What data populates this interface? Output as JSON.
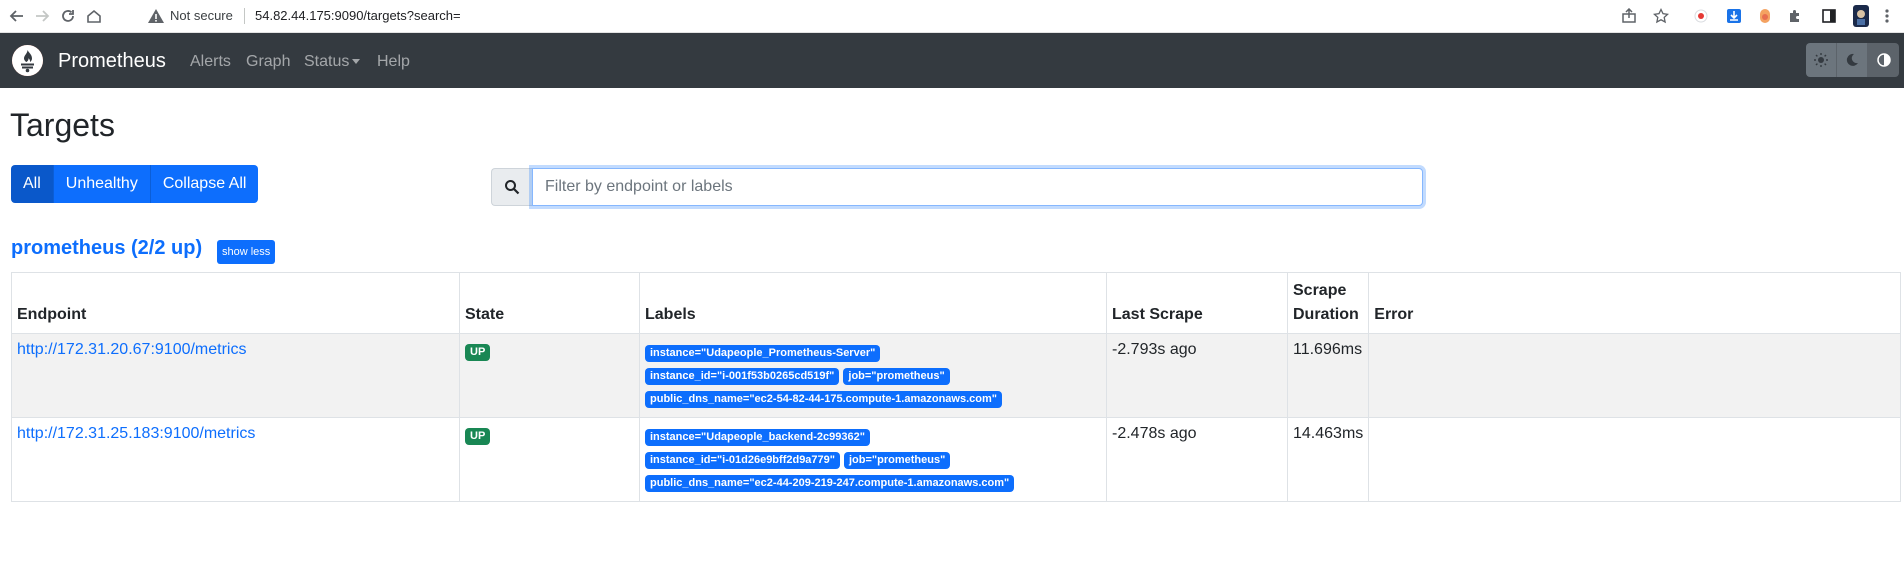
{
  "browser": {
    "security_label": "Not secure",
    "url": "54.82.44.175:9090/targets?search="
  },
  "navbar": {
    "brand": "Prometheus",
    "links": [
      {
        "label": "Alerts"
      },
      {
        "label": "Graph"
      },
      {
        "label": "Status"
      },
      {
        "label": "Help"
      }
    ]
  },
  "page": {
    "title": "Targets",
    "filter_buttons": [
      "All",
      "Unhealthy",
      "Collapse All"
    ],
    "active_filter": "All",
    "search_placeholder": "Filter by endpoint or labels"
  },
  "pool": {
    "title": "prometheus (2/2 up)",
    "toggle_label": "show less",
    "columns": [
      "Endpoint",
      "State",
      "Labels",
      "Last Scrape",
      "Scrape Duration",
      "Error"
    ],
    "rows": [
      {
        "endpoint": "http://172.31.20.67:9100/metrics",
        "state": "UP",
        "labels": [
          "instance=\"Udapeople_Prometheus-Server\"",
          "instance_id=\"i-001f53b0265cd519f\"",
          "job=\"prometheus\"",
          "public_dns_name=\"ec2-54-82-44-175.compute-1.amazonaws.com\""
        ],
        "last_scrape": "-2.793s ago",
        "scrape_duration": "11.696ms",
        "error": ""
      },
      {
        "endpoint": "http://172.31.25.183:9100/metrics",
        "state": "UP",
        "labels": [
          "instance=\"Udapeople_backend-2c99362\"",
          "instance_id=\"i-01d26e9bff2d9a779\"",
          "job=\"prometheus\"",
          "public_dns_name=\"ec2-44-209-219-247.compute-1.amazonaws.com\""
        ],
        "last_scrape": "-2.478s ago",
        "scrape_duration": "14.463ms",
        "error": ""
      }
    ]
  },
  "colors": {
    "navbar_bg": "#343a40",
    "primary": "#0d6efd",
    "success": "#198754"
  }
}
